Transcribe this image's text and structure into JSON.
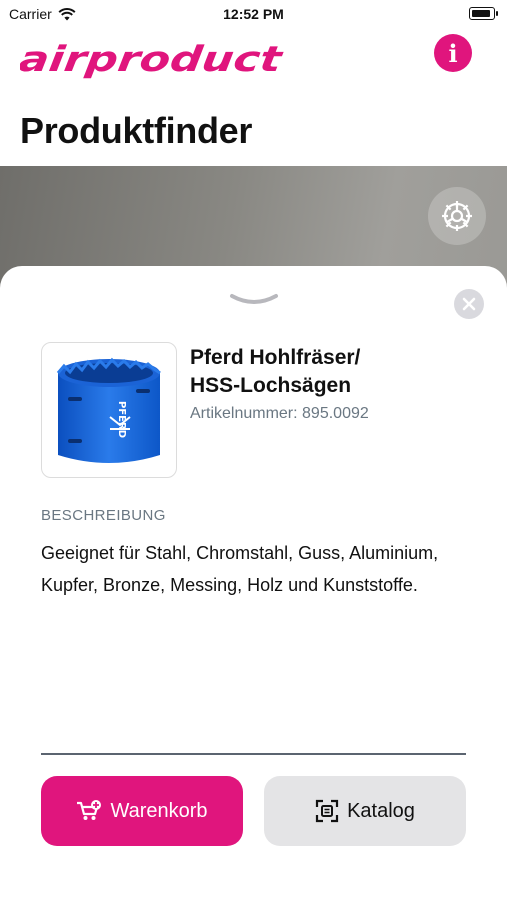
{
  "status_bar": {
    "carrier": "Carrier",
    "time": "12:52 PM"
  },
  "header": {
    "logo_text": "airproduct",
    "page_title": "Produktfinder"
  },
  "product": {
    "title_line1": "Pferd Hohlfräser/",
    "title_line2": "HSS-Lochsägen",
    "article_number": "Artikelnummer: 895.0092",
    "image_label": "PFERD"
  },
  "description": {
    "label": "BESCHREIBUNG",
    "text": "Geeignet für Stahl, Chromstahl, Guss, Aluminium, Kupfer, Bronze, Messing, Holz und Kunststoffe."
  },
  "actions": {
    "cart_label": "Warenkorb",
    "catalog_label": "Katalog"
  },
  "colors": {
    "accent": "#e0157d",
    "secondary_button": "#e4e4e6",
    "muted_text": "#6a7782"
  },
  "icons": [
    "wifi-icon",
    "battery-icon",
    "info-icon",
    "gear-icon",
    "chevron-down-icon",
    "close-icon",
    "cart-add-icon",
    "scan-icon"
  ]
}
